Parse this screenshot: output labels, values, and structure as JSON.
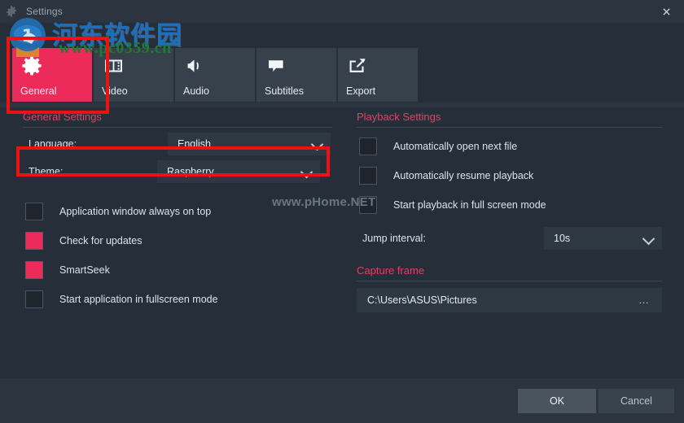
{
  "window": {
    "title": "Settings",
    "icon": "gear-icon",
    "close_label": "×"
  },
  "tabs": [
    {
      "label": "General",
      "icon": "gear-icon",
      "active": true
    },
    {
      "label": "Video",
      "icon": "filmstrip-icon",
      "active": false
    },
    {
      "label": "Audio",
      "icon": "speaker-icon",
      "active": false
    },
    {
      "label": "Subtitles",
      "icon": "speech-bubble-icon",
      "active": false
    },
    {
      "label": "Export",
      "icon": "export-arrow-icon",
      "active": false
    }
  ],
  "general": {
    "section_title": "General Settings",
    "language_label": "Language:",
    "language_value": "English",
    "theme_label": "Theme:",
    "theme_value": "Raspberry",
    "checks": [
      {
        "label": "Application window always on top",
        "checked": false
      },
      {
        "label": "Check for updates",
        "checked": true
      },
      {
        "label": "SmartSeek",
        "checked": true
      },
      {
        "label": "Start application in fullscreen mode",
        "checked": false
      }
    ]
  },
  "playback": {
    "section_title": "Playback Settings",
    "checks": [
      {
        "label": "Automatically open next file",
        "checked": false
      },
      {
        "label": "Automatically resume playback",
        "checked": false
      },
      {
        "label": "Start playback in full screen mode",
        "checked": false
      }
    ],
    "jump_label": "Jump interval:",
    "jump_value": "10s"
  },
  "capture": {
    "section_title": "Capture frame",
    "path_value": "C:\\Users\\ASUS\\Pictures",
    "browse_label": "…"
  },
  "footer": {
    "ok_label": "OK",
    "cancel_label": "Cancel"
  },
  "watermarks": {
    "site_cn": "河东软件园",
    "site_url": "www.pc0359.cn",
    "center": "www.pHome.NET"
  },
  "colors": {
    "accent": "#ec2b5b",
    "section_heading": "#ef3a63",
    "dialog_bg": "#262f39",
    "panel_bg": "#2c353f",
    "field_bg": "#2e3843",
    "tab_bg": "#37414c",
    "annotation": "#ef1111"
  }
}
